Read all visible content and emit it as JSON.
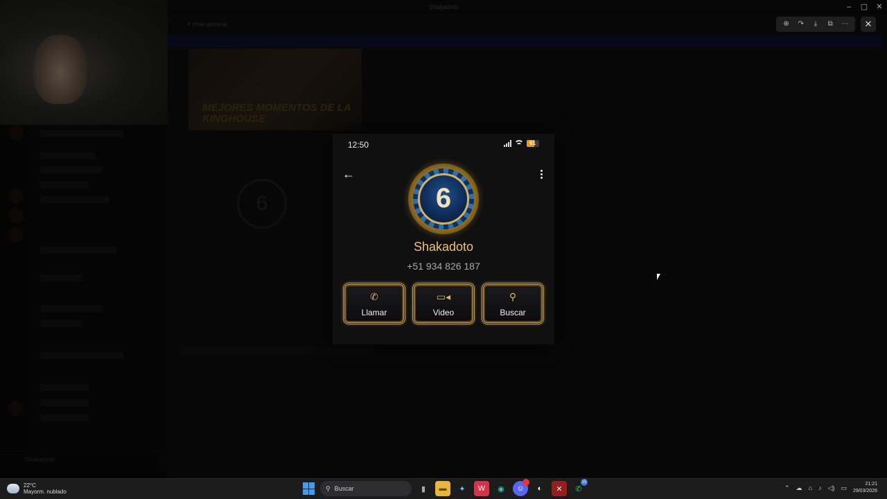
{
  "background_app": {
    "window_title": "Shakadoto",
    "channel_name": "# chat-general",
    "banner_text": "",
    "thumbnail_text": "MEJORES MOMENTOS DE LA KINGHOUSE",
    "user_name": "Shakadoto"
  },
  "viewer": {
    "toolbar": [
      "zoom-icon",
      "share-icon",
      "download-icon",
      "open-external-icon",
      "more-icon"
    ],
    "close_label": "✕"
  },
  "phone": {
    "time": "12:50",
    "battery": "61",
    "battery_level": 0.61,
    "contact": {
      "avatar_text": "6",
      "name": "Shakadoto",
      "number": "+51 934 826 187"
    },
    "actions": [
      {
        "label": "Llamar",
        "icon": "phone-icon"
      },
      {
        "label": "Video",
        "icon": "video-icon"
      },
      {
        "label": "Buscar",
        "icon": "search-icon"
      }
    ]
  },
  "taskbar": {
    "weather_temp": "22°C",
    "weather_desc": "Mayorm. nublado",
    "search_placeholder": "Buscar",
    "time": "21:21",
    "date": "29/03/2026",
    "discord_badge": "",
    "whatsapp_badge": "15"
  },
  "colors": {
    "gold": "#caa24b",
    "name_gold": "#ecc36a",
    "battery": "#e69a1a"
  }
}
